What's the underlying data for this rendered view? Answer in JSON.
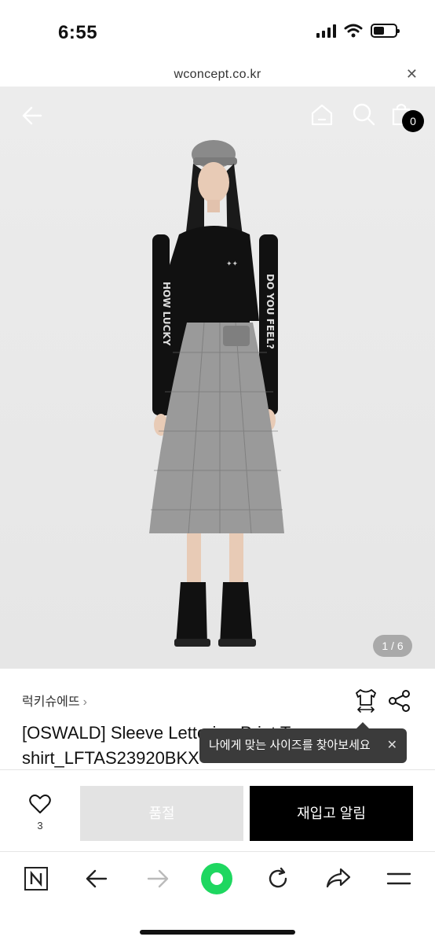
{
  "status": {
    "time": "6:55"
  },
  "browser": {
    "url": "wconcept.co.kr"
  },
  "hero": {
    "cart_count": "0",
    "image_counter": "1 / 6"
  },
  "product": {
    "brand": "럭키슈에뜨",
    "title": "[OSWALD] Sleeve L... shirt_LFTAS23920BKX",
    "title_line1": "[OSWALD] Sleeve L",
    "title_line1_tail": "ettering Print T-",
    "title_line2": "shirt_LFTAS23920BKX",
    "size_tooltip": "나에게 맞는 사이즈를 찾아보세요"
  },
  "buybar": {
    "like_count": "3",
    "soldout_label": "품절",
    "notify_label": "재입고 알림"
  },
  "colors": {
    "accent_green": "#1ed760",
    "soldout_bg": "#e3e3e3",
    "notify_bg": "#000000"
  }
}
